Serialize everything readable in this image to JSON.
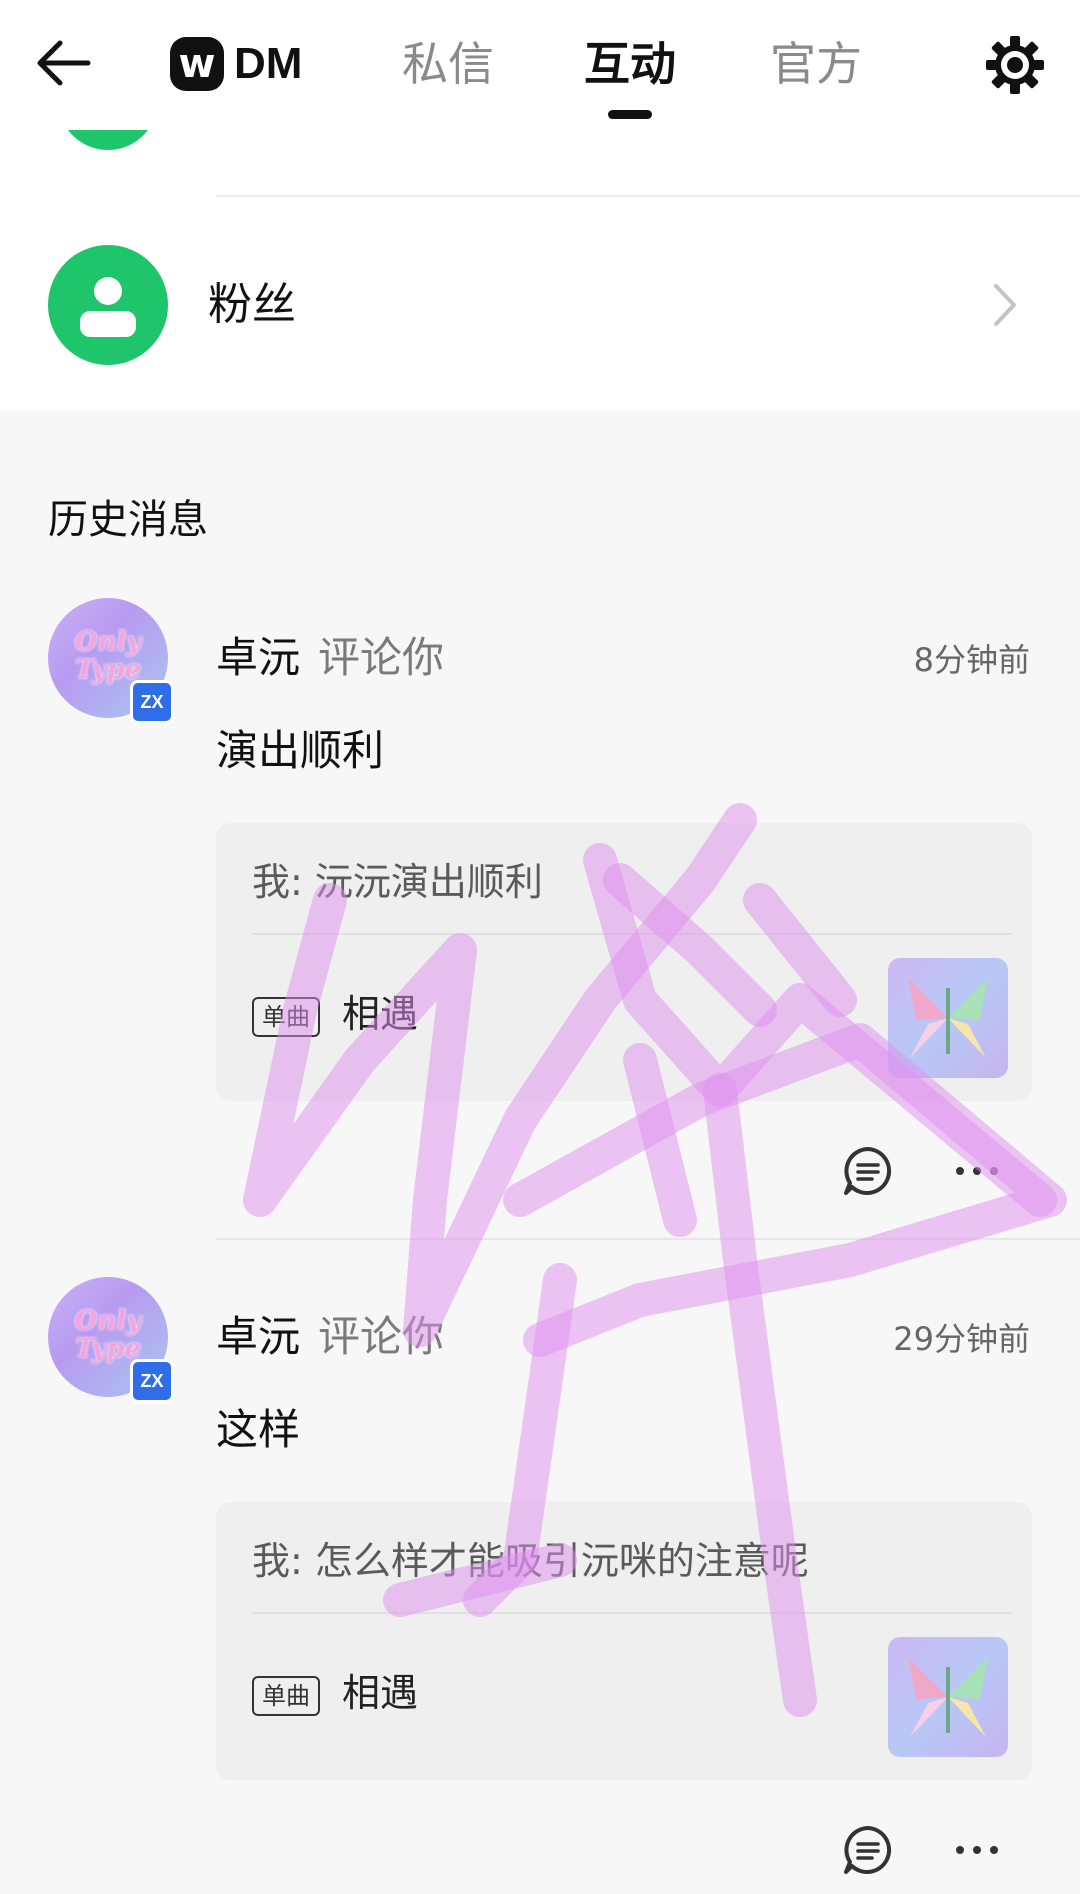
{
  "header": {
    "brand_badge": "w",
    "brand_text": "DM",
    "tabs": [
      {
        "label": "私信",
        "active": false
      },
      {
        "label": "互动",
        "active": true
      },
      {
        "label": "官方",
        "active": false
      }
    ],
    "icons": {
      "back": "back-arrow-icon",
      "settings": "gear-icon"
    }
  },
  "fans": {
    "label": "粉丝",
    "icon": "person-icon",
    "accent_color": "#1ec56a"
  },
  "history": {
    "title": "历史消息",
    "items": [
      {
        "avatar_text": "Only Type",
        "avatar_badge": "ZX",
        "user": "卓沅",
        "action": "评论你",
        "time": "8分钟前",
        "comment": "演出顺利",
        "quote": "我: 沅沅演出顺利",
        "song_tag": "单曲",
        "song_name": "相遇"
      },
      {
        "avatar_text": "Only Type",
        "avatar_badge": "ZX",
        "user": "卓沅",
        "action": "评论你",
        "time": "29分钟前",
        "comment": "这样",
        "quote": "我: 怎么样才能吸引沅咪的注意呢",
        "song_tag": "单曲",
        "song_name": "相遇"
      }
    ]
  },
  "colors": {
    "active_tab": "#111111",
    "inactive_tab": "#8a8a8a",
    "scribble": "#e08ff0"
  }
}
